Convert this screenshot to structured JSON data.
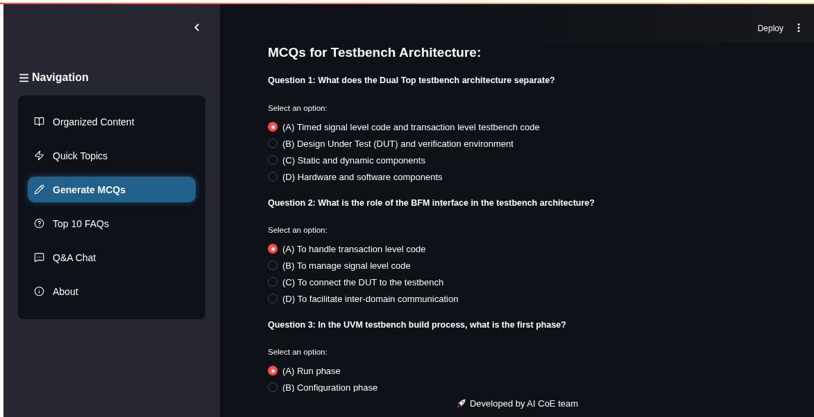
{
  "sidebar": {
    "title": "Navigation",
    "items": [
      {
        "label": "Organized Content",
        "selected": false
      },
      {
        "label": "Quick Topics",
        "selected": false
      },
      {
        "label": "Generate MCQs",
        "selected": true
      },
      {
        "label": "Top 10 FAQs",
        "selected": false
      },
      {
        "label": "Q&A Chat",
        "selected": false
      },
      {
        "label": "About",
        "selected": false
      }
    ]
  },
  "header": {
    "deploy": "Deploy"
  },
  "main": {
    "title": "MCQs for Testbench Architecture:",
    "questions": [
      {
        "question": "Question 1: What does the Dual Top testbench architecture separate?",
        "prompt": "Select an option:",
        "options": [
          {
            "label": "(A) Timed signal level code and transaction level testbench code",
            "selected": true
          },
          {
            "label": "(B) Design Under Test (DUT) and verification environment",
            "selected": false
          },
          {
            "label": "(C) Static and dynamic components",
            "selected": false
          },
          {
            "label": "(D) Hardware and software components",
            "selected": false
          }
        ]
      },
      {
        "question": "Question 2: What is the role of the BFM interface in the testbench architecture?",
        "prompt": "Select an option:",
        "options": [
          {
            "label": "(A) To handle transaction level code",
            "selected": true
          },
          {
            "label": "(B) To manage signal level code",
            "selected": false
          },
          {
            "label": "(C) To connect the DUT to the testbench",
            "selected": false
          },
          {
            "label": "(D) To facilitate inter-domain communication",
            "selected": false
          }
        ]
      },
      {
        "question": "Question 3: In the UVM testbench build process, what is the first phase?",
        "prompt": "Select an option:",
        "options": [
          {
            "label": "(A) Run phase",
            "selected": true
          },
          {
            "label": "(B) Configuration phase",
            "selected": false
          }
        ]
      }
    ]
  },
  "footer": {
    "text": "Developed by AI CoE team"
  }
}
